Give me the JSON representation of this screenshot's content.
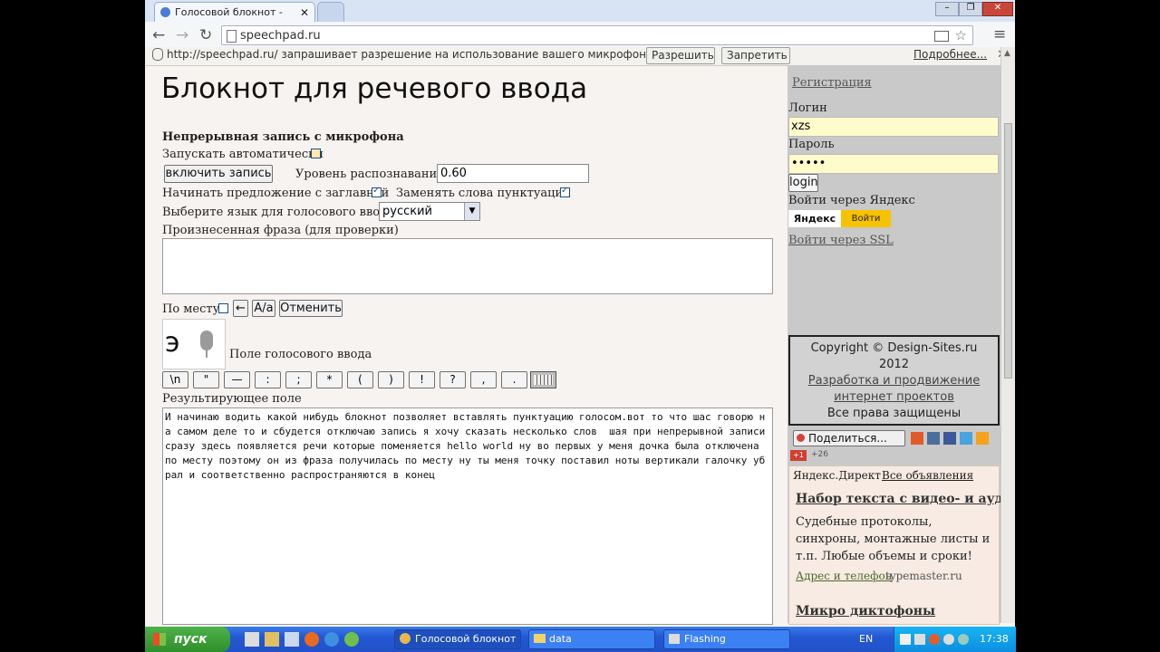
{
  "browser": {
    "tab_title": "Голосовой блокнот - Speec",
    "url": "speechpad.ru",
    "infobar_text": "http://speechpad.ru/ запрашивает разрешение на использование вашего микрофона.",
    "allow_label": "Разрешить",
    "deny_label": "Запретить",
    "more_label": "Подробнее..."
  },
  "page": {
    "heading": "Блокнот для речевого ввода",
    "continuous_label": "Непрерывная запись с микрофона",
    "autostart_label": "Запускать автоматически",
    "record_button": "включить запись",
    "recognition_level_label": "Уровень распознавания",
    "recognition_level_value": "0.60",
    "capitalize_label": "Начинать предложение с заглавной",
    "punctuation_label": "Заменять слова пунктуации",
    "language_label": "Выберите язык для голосового ввода",
    "language_value": "русский",
    "spoken_phrase_label": "Произнесенная фраза (для проверки)",
    "in_place_label": "По месту",
    "backspace_label": "←",
    "case_label": "A/a",
    "undo_label": "Отменить",
    "voice_field_label": "Поле голосового ввода",
    "mic_glyph": "э",
    "punct_buttons": [
      "\\n",
      "\"",
      "—",
      ":",
      ";",
      "*",
      "(",
      ")",
      "!",
      "?",
      ",",
      "."
    ],
    "result_label": "Результирующее поле",
    "result_text": "И начинаю водить какой нибудь блокнот позволяет вставлять пунктуацию голосом.вот то что шас говорю на самом деле то и сбудется отключаю запись я хочу сказать несколько слов  шая при непрерывной записи сразу здесь появляется речи которые поменяется hello world ну во первых у меня дочка была отключена по месту поэтому он из фраза получилась по месту ну ты меня точку поставил ноты вертикали галочку убрал и соответственно распространяются в конец"
  },
  "sidebar": {
    "register_link": "Регистрация",
    "login_label": "Логин",
    "login_value": "xzs",
    "password_label": "Пароль",
    "password_value": "•••••",
    "login_button": "login",
    "yandex_login_label": "Войти через Яндекс",
    "yandex_brand": "Яндекс",
    "yandex_button": "Войти",
    "ssl_link": "Войти через SSL",
    "copyright_line1": "Copyright © Design-Sites.ru",
    "copyright_year": "2012",
    "copyright_link": "Разработка и продвижение интернет проектов",
    "rights": "Все права защищены",
    "share_button": "Поделиться...",
    "gplus_count": "+26",
    "direct_brand": "Яндекс.Директ",
    "all_ads": "Все объявления",
    "ad1_title": "Набор текста с видео- и аудио",
    "ad1_text": "Судебные протоколы, синхроны, монтажные листы и т.п. Любые объемы и сроки!",
    "ad1_link": "Адрес и телефон",
    "ad1_domain": "typemaster.ru",
    "ad2_title": "Микро диктофоны"
  },
  "taskbar": {
    "start_label": "пуск",
    "tasks": [
      "Голосовой блокнот ...",
      "data",
      "Flashing"
    ],
    "lang": "EN",
    "time": "17:38"
  },
  "colors": {
    "page_bg": "#f7f3f1",
    "sidebar_bg": "#c9c9c9",
    "input_highlight": "#fffccc",
    "taskbar_blue": "#2457d4"
  }
}
